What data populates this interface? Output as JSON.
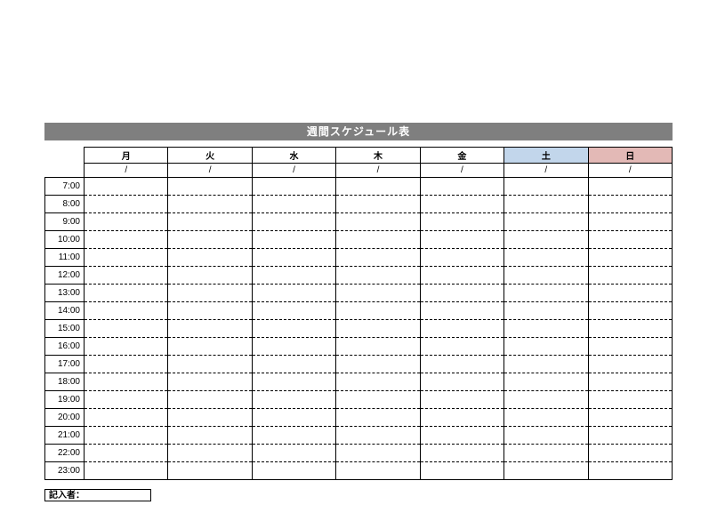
{
  "title": "週間スケジュール表",
  "days": [
    "月",
    "火",
    "水",
    "木",
    "金",
    "土",
    "日"
  ],
  "dates": [
    "/",
    "/",
    "/",
    "/",
    "/",
    "/",
    "/"
  ],
  "times": [
    "7:00",
    "8:00",
    "9:00",
    "10:00",
    "11:00",
    "12:00",
    "13:00",
    "14:00",
    "15:00",
    "16:00",
    "17:00",
    "18:00",
    "19:00",
    "20:00",
    "21:00",
    "22:00",
    "23:00"
  ],
  "note_label": "記入者："
}
